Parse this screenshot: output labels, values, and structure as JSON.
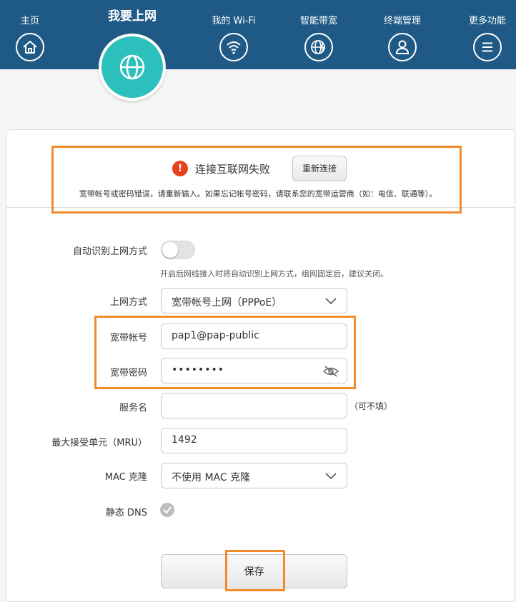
{
  "nav": {
    "home": "主页",
    "internet": "我要上网",
    "wifi": "我的 Wi-Fi",
    "bandwidth": "智能带宽",
    "devices": "终端管理",
    "more": "更多功能"
  },
  "alert": {
    "title": "连接互联网失败",
    "reconnect_label": "重新连接",
    "message": "宽带帐号或密码错误，请重新输入。如果忘记帐号密码，请联系您的宽带运营商（如：电信、联通等）。"
  },
  "form": {
    "auto_detect_label": "自动识别上网方式",
    "auto_detect_on": false,
    "auto_detect_hint": "开启后网线接入时将自动识别上网方式，组网固定后，建议关闭。",
    "mode_label": "上网方式",
    "mode_value": "宽带帐号上网（PPPoE）",
    "account_label": "宽带帐号",
    "account_value": "pap1@pap-public",
    "password_label": "宽带密码",
    "password_value": "••••••••",
    "service_label": "服务名",
    "service_value": "",
    "service_hint": "（可不填）",
    "mru_label": "最大接受单元（MRU）",
    "mru_value": "1492",
    "mac_label": "MAC 克隆",
    "mac_value": "不使用 MAC 克隆",
    "dns_label": "静态 DNS",
    "save_label": "保存"
  },
  "colors": {
    "header_bg": "#1e5a85",
    "active_accent": "#2cc0bd",
    "highlight": "#f28c2b",
    "error": "#e8401e"
  }
}
